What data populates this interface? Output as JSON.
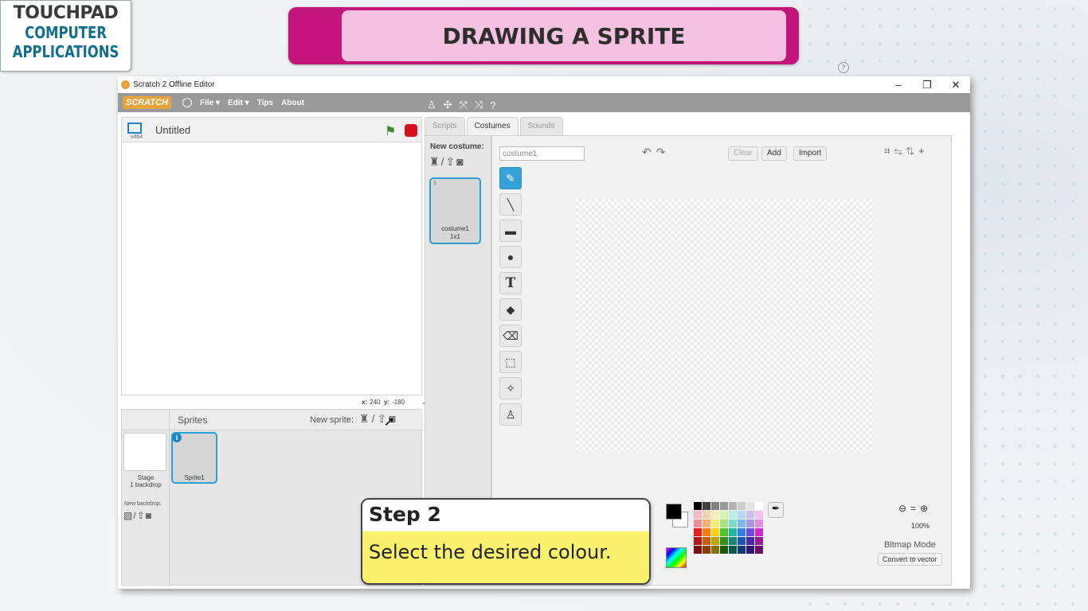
{
  "logo": {
    "brand": "TOUCHPAD",
    "line1": "COMPUTER",
    "line2": "APPLICATIONS"
  },
  "banner": {
    "title": "DRAWING A SPRITE"
  },
  "window": {
    "title": "Scratch 2 Offline Editor",
    "controls": [
      "–",
      "❐",
      "✕"
    ]
  },
  "menubar": {
    "logo": "SCRATCH",
    "items": [
      "File ▾",
      "Edit ▾",
      "Tips",
      "About"
    ],
    "tools": [
      "♙",
      "✣",
      "⤧",
      "⤨",
      "?"
    ]
  },
  "stage": {
    "project_title": "Untitled",
    "version": "v454",
    "coords_x_label": "x:",
    "coords_x": "240",
    "coords_y_label": "y:",
    "coords_y": "-180"
  },
  "sprites": {
    "title": "Sprites",
    "new_sprite_label": "New sprite:",
    "stage_label": "Stage",
    "stage_backdrops": "1 backdrop",
    "new_backdrop_label": "New backdrop:",
    "sprite_name": "Sprite1",
    "info": "i"
  },
  "tabs": [
    "Scripts",
    "Costumes",
    "Sounds"
  ],
  "costumes": {
    "new_costume_label": "New costume:",
    "item_number": "1",
    "item_name": "costume1",
    "item_size": "1x1"
  },
  "editor": {
    "costume_name_value": "costume1",
    "clear": "Clear",
    "add": "Add",
    "import": "Import",
    "zoom_pct": "100%",
    "mode_label": "Bitmap Mode",
    "convert_label": "Convert to vector",
    "colors": {
      "foreground": "#000000",
      "background": "#ffffff",
      "accent": "#35a1d8"
    },
    "palette": [
      "#000000",
      "#404040",
      "#808080",
      "#999999",
      "#b3b3b3",
      "#cccccc",
      "#e6e6e6",
      "#ffffff",
      "#f4b8c8",
      "#f8d2b0",
      "#fbf2b5",
      "#d8f2b3",
      "#bdeee4",
      "#b8d8f4",
      "#c9c0f2",
      "#f0c0ee",
      "#f08b9c",
      "#f6b07a",
      "#f9e87a",
      "#a8e27f",
      "#7fd9c9",
      "#82b6ee",
      "#a596eb",
      "#e38de0",
      "#e52020",
      "#f07d18",
      "#f5d212",
      "#53c22a",
      "#1fb7a1",
      "#2e7fe0",
      "#6a4ae0",
      "#d02cc8",
      "#b5151a",
      "#c85e10",
      "#c4a40c",
      "#35901a",
      "#138676",
      "#1d57b0",
      "#4628b0",
      "#9a1a96",
      "#7d0d10",
      "#8a3e08",
      "#857008",
      "#1f5c0e",
      "#0b5a4f",
      "#123a78",
      "#2d1878",
      "#6a0f66"
    ]
  },
  "step": {
    "heading": "Step 2",
    "instruction": "Select the desired colour."
  }
}
